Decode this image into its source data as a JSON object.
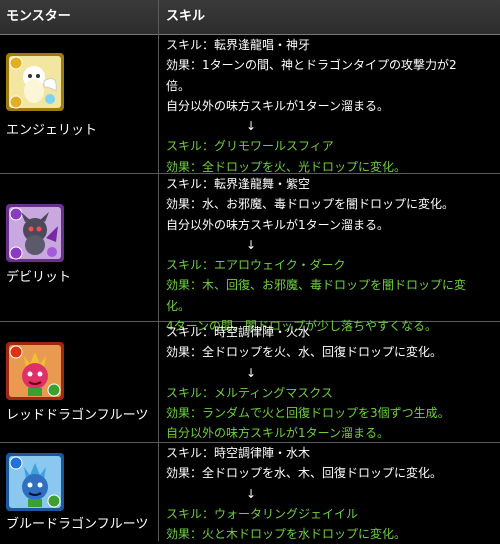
{
  "header": {
    "col_monster": "モンスター",
    "col_skill": "スキル"
  },
  "rows": [
    {
      "monster": "エンジェリット",
      "lines": [
        "スキル：転界逢龍唱・神牙",
        "効果：1ターンの間、神とドラゴンタイプの攻撃力が2",
        "倍。",
        "自分以外の味方スキルが1ターン溜まる。",
        "↓",
        "スキル：グリモワールスフィア",
        "効果：全ドロップを火、光ドロップに変化。"
      ]
    },
    {
      "monster": "デビリット",
      "lines": [
        "スキル：転界逢龍舞・紫空",
        "効果：水、お邪魔、毒ドロップを闇ドロップに変化。",
        "自分以外の味方スキルが1ターン溜まる。",
        "↓",
        "スキル：エアロウェイク・ダーク",
        "効果：木、回復、お邪魔、毒ドロップを闇ドロップに変",
        "化。",
        "4ターンの間、闇ドロップが少し落ちやすくなる。"
      ]
    },
    {
      "monster": "レッドドラゴンフルーツ",
      "lines": [
        "スキル：時空調律陣・火水",
        "効果：全ドロップを火、水、回復ドロップに変化。",
        "↓",
        "スキル：メルティングマスクス",
        "効果：ランダムで火と回復ドロップを3個ずつ生成。",
        "自分以外の味方スキルが1ターン溜まる。"
      ]
    },
    {
      "monster": "ブルードラゴンフルーツ",
      "lines": [
        "スキル：時空調律陣・水木",
        "効果：全ドロップを水、木、回復ドロップに変化。",
        "↓",
        "スキル：ウォータリングジェイイル",
        "効果：火と木ドロップを水ドロップに変化。"
      ]
    }
  ]
}
